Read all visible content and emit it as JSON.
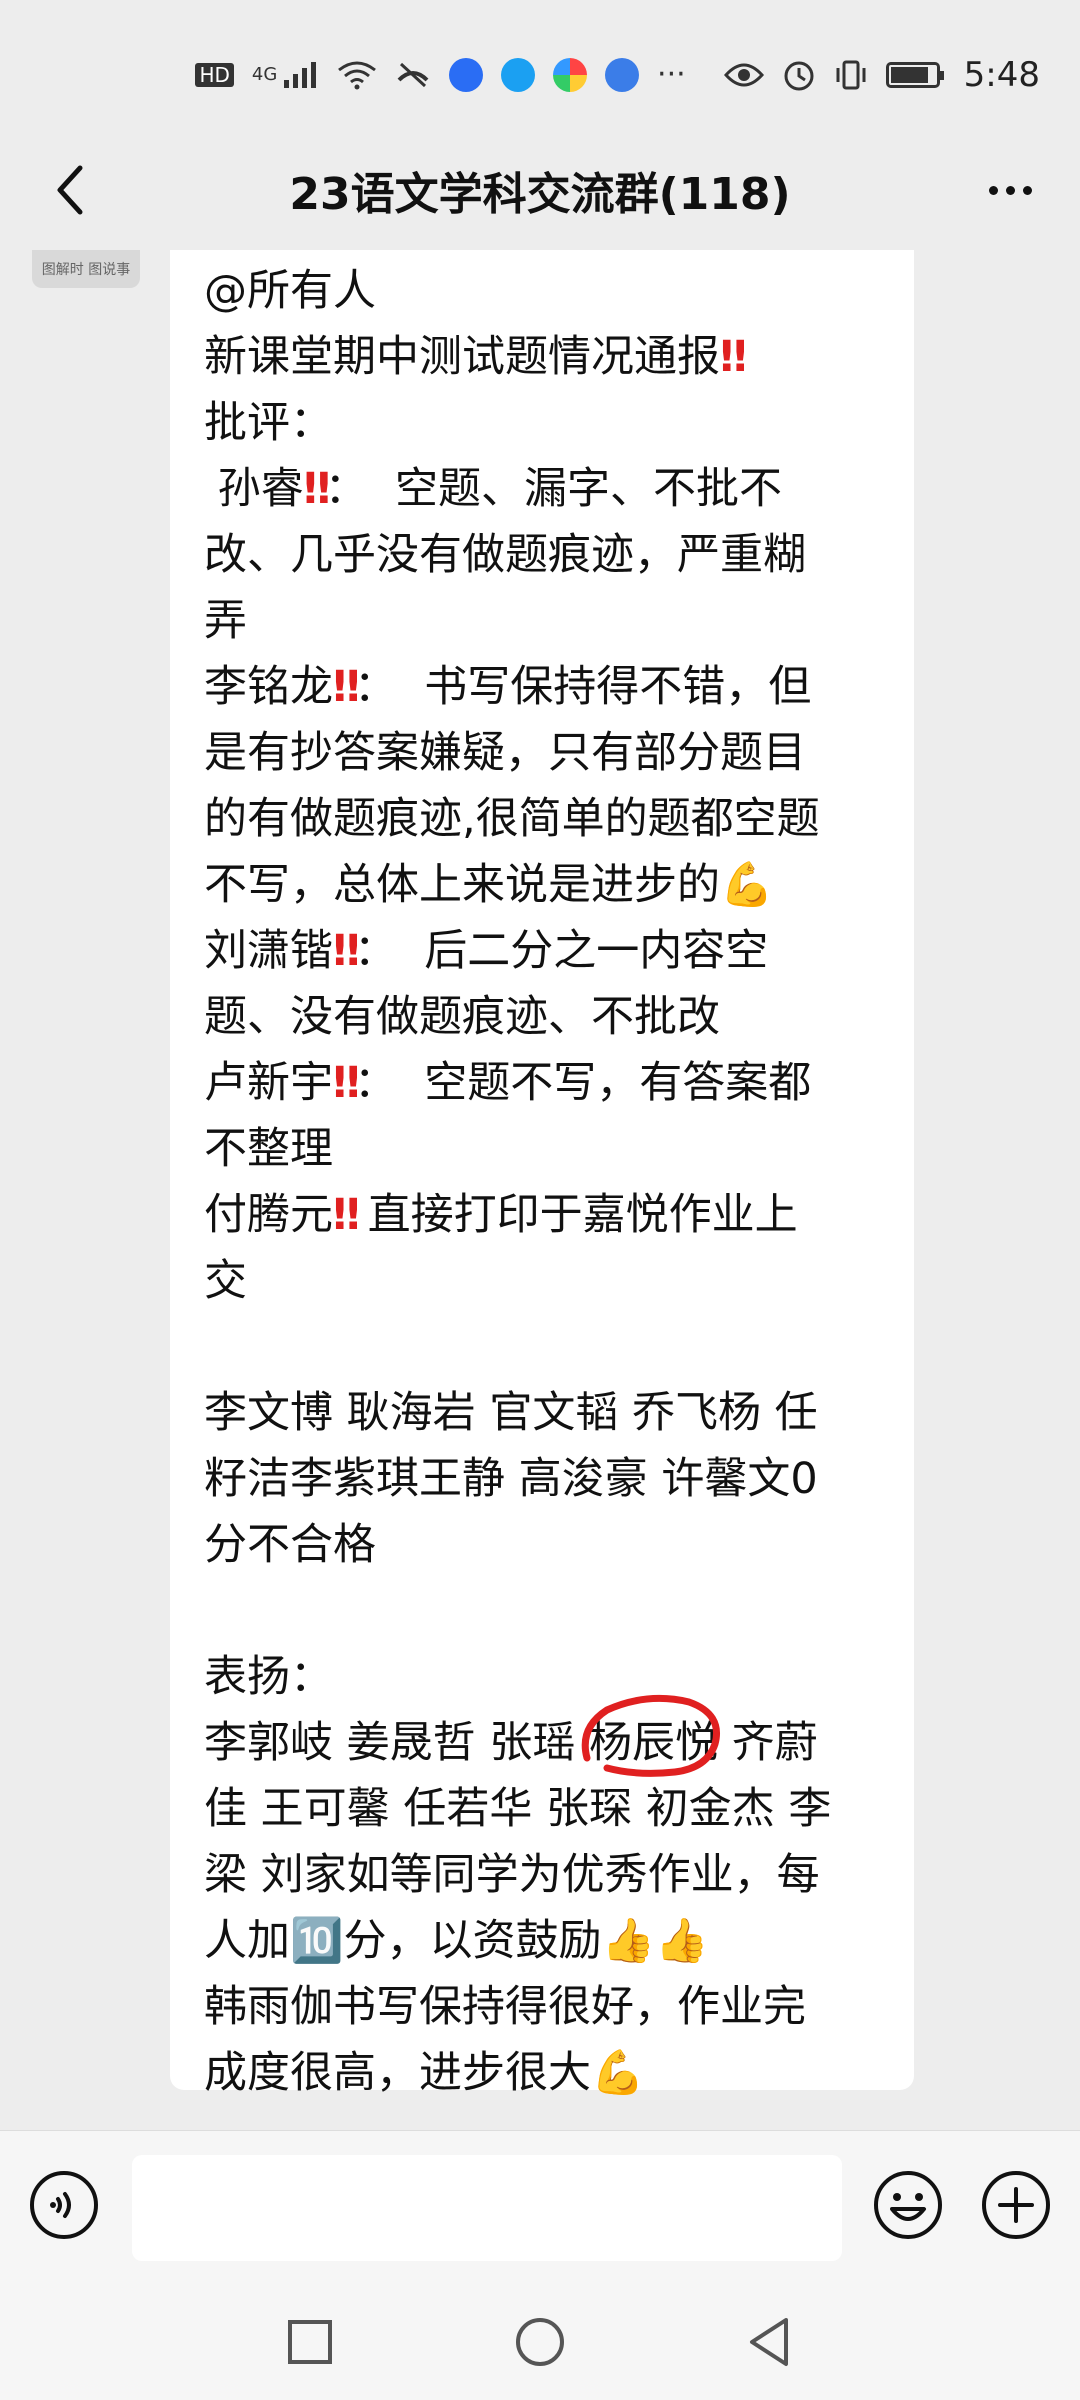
{
  "status_bar": {
    "hd": "HD",
    "network": "4G",
    "more": "···",
    "time": "5:48"
  },
  "header": {
    "title": "23语文学科交流群(118)"
  },
  "avatar_text": "图解时 图说事",
  "message": {
    "lines": [
      [
        {
          "t": "@所有人"
        }
      ],
      [
        {
          "t": "新课堂期中测试题情况通报"
        },
        {
          "t": "‼",
          "c": "bang"
        }
      ],
      [
        {
          "t": "批评："
        }
      ],
      [
        {
          "t": " 孙睿"
        },
        {
          "t": "‼",
          "c": "bang"
        },
        {
          "t": "：  空题、漏字、不批不"
        }
      ],
      [
        {
          "t": "改、几乎没有做题痕迹，严重糊"
        }
      ],
      [
        {
          "t": "弄"
        }
      ],
      [
        {
          "t": "李铭龙"
        },
        {
          "t": "‼",
          "c": "bang"
        },
        {
          "t": "：  书写保持得不错，但"
        }
      ],
      [
        {
          "t": "是有抄答案嫌疑，只有部分题目"
        }
      ],
      [
        {
          "t": "的有做题痕迹,很简单的题都空题"
        }
      ],
      [
        {
          "t": "不写，总体上来说是进步的💪"
        }
      ],
      [
        {
          "t": "刘潇锴"
        },
        {
          "t": "‼",
          "c": "bang"
        },
        {
          "t": "：  后二分之一内容空"
        }
      ],
      [
        {
          "t": "题、没有做题痕迹、不批改"
        }
      ],
      [
        {
          "t": "卢新宇"
        },
        {
          "t": "‼",
          "c": "bang"
        },
        {
          "t": "：  空题不写，有答案都"
        }
      ],
      [
        {
          "t": "不整理"
        }
      ],
      [
        {
          "t": "付腾元"
        },
        {
          "t": "‼",
          "c": "bang"
        },
        {
          "t": " 直接打印于嘉悦作业上"
        }
      ],
      [
        {
          "t": "交"
        }
      ],
      [],
      [
        {
          "t": "李文博 耿海岩 官文韬 乔飞杨 任"
        }
      ],
      [
        {
          "t": "籽洁李紫琪王静 高浚豪 许馨文0"
        }
      ],
      [
        {
          "t": "分不合格"
        }
      ],
      [],
      [
        {
          "t": "表扬："
        }
      ],
      [
        {
          "t": "李郭岐 姜晟哲 张瑶 "
        },
        {
          "t": "杨辰悦",
          "c": "circled"
        },
        {
          "t": " 齐蔚"
        }
      ],
      [
        {
          "t": "佳 王可馨 任若华 张琛 初金杰 李"
        }
      ],
      [
        {
          "t": "梁 刘家如等同学为优秀作业，每"
        }
      ],
      [
        {
          "t": "人加🔟分，以资鼓励👍👍"
        }
      ],
      [
        {
          "t": "韩雨伽书写保持得很好，作业完"
        }
      ],
      [
        {
          "t": "成度很高，进步很大💪"
        }
      ]
    ]
  },
  "input": {
    "placeholder": ""
  },
  "colors": {
    "bubble": "#ffffff",
    "background": "#ededed",
    "alert_red": "#e02020"
  }
}
